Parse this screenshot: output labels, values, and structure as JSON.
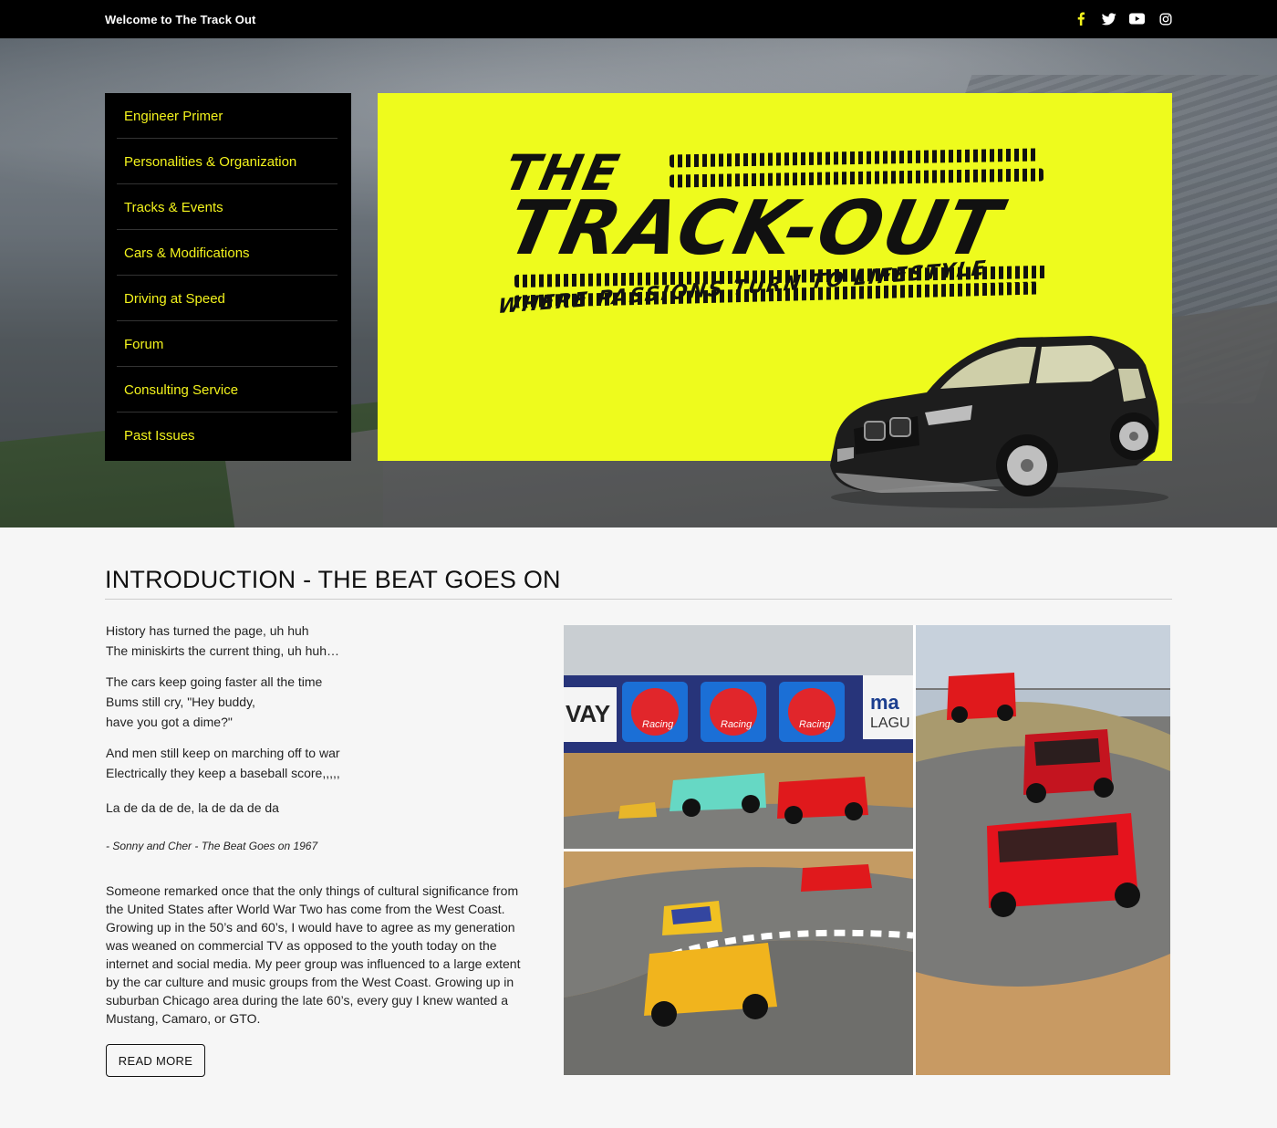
{
  "topbar": {
    "welcome": "Welcome to The Track Out",
    "social": [
      "facebook-icon",
      "twitter-icon",
      "youtube-icon",
      "instagram-icon"
    ]
  },
  "nav": {
    "items": [
      "Engineer Primer",
      "Personalities & Organization",
      "Tracks & Events",
      "Cars & Modifications",
      "Driving at Speed",
      "Forum",
      "Consulting Service",
      "Past Issues"
    ]
  },
  "banner": {
    "logo_the": "THE",
    "logo_trackout": "TRACK-OUT",
    "logo_tagline": "WHERE PASSIONS TURN TO LIFESTYLE"
  },
  "colors": {
    "accent": "#f2f21c",
    "banner_bg": "#eefb1d",
    "nav_bg": "#000000"
  },
  "intro": {
    "title": "INTRODUCTION - THE BEAT GOES ON",
    "lyrics": [
      [
        "History has turned the page, uh huh",
        "The miniskirts the current thing, uh huh…"
      ],
      [
        "The cars keep going faster all the time",
        "Bums still cry, \"Hey buddy,",
        "have you got a dime?\""
      ],
      [
        "And men still keep on marching off to war",
        "Electrically they keep a baseball score,,,,,"
      ],
      [
        "La de da de de, la de da de da"
      ]
    ],
    "attribution": "- Sonny and Cher - The Beat Goes on 1967",
    "body": "Someone remarked once that the only things of cultural significance from the United States after World War Two has come from the West Coast. Growing up in the 50’s and 60’s, I would have to agree as my generation was weaned on commercial TV as opposed to the youth today on the internet and social media. My peer group was influenced to a large extent by the car culture and music groups from the West Coast. Growing up in suburban Chicago area during the late 60’s, every guy I knew wanted a Mustang, Camaro, or GTO.",
    "read_more": "READ MORE"
  },
  "photo_sign": {
    "left": "VAY",
    "brand": "Racing",
    "right_top": "ma",
    "right_bottom": "LAGU"
  }
}
